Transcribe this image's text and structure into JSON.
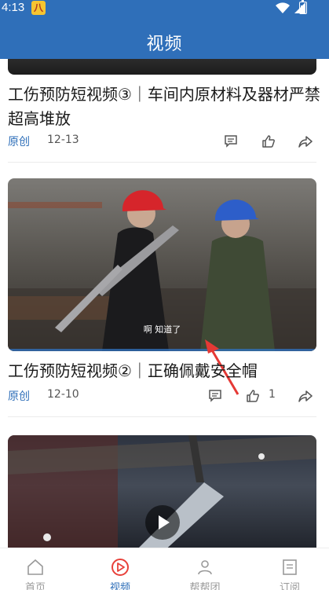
{
  "status_bar": {
    "time": "4:13",
    "notification_icon": "八"
  },
  "header": {
    "title": "视频"
  },
  "feed": {
    "items": [
      {
        "title": "工伤预防短视频③｜车间内原材料及器材严禁超高堆放",
        "source": "原创",
        "date": "12-13"
      },
      {
        "title": "工伤预防短视频②｜正确佩戴安全帽",
        "source": "原创",
        "date": "12-10",
        "likes": "1",
        "subtitle": "啊 知道了"
      },
      {
        "title": "",
        "source": "",
        "date": ""
      }
    ]
  },
  "tabbar": {
    "tabs": [
      {
        "label": "首页"
      },
      {
        "label": "视频"
      },
      {
        "label": "帮帮团"
      },
      {
        "label": "订阅"
      }
    ]
  },
  "colors": {
    "brand": "#2f6fb9",
    "active_tab_icon": "#e8413a"
  }
}
